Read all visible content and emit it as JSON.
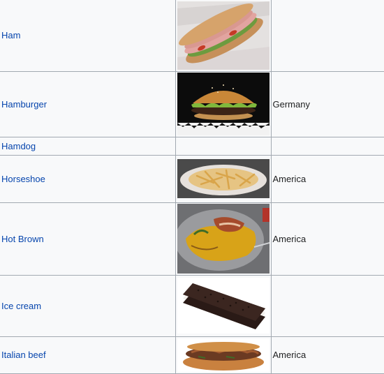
{
  "rows": [
    {
      "name": "Ham",
      "image": "ham sandwich photo",
      "origin": ""
    },
    {
      "name": "Hamburger",
      "image": "hamburger photo",
      "origin": "Germany"
    },
    {
      "name": "Hamdog",
      "image": "",
      "origin": ""
    },
    {
      "name": "Horseshoe",
      "image": "horseshoe sandwich photo",
      "origin": "America"
    },
    {
      "name": "Hot Brown",
      "image": "hot brown sandwich photo",
      "origin": "America"
    },
    {
      "name": "Ice cream",
      "image": "ice cream sandwich photo",
      "origin": ""
    },
    {
      "name": "Italian beef",
      "image": "italian beef sandwich photo",
      "origin": "America"
    }
  ]
}
